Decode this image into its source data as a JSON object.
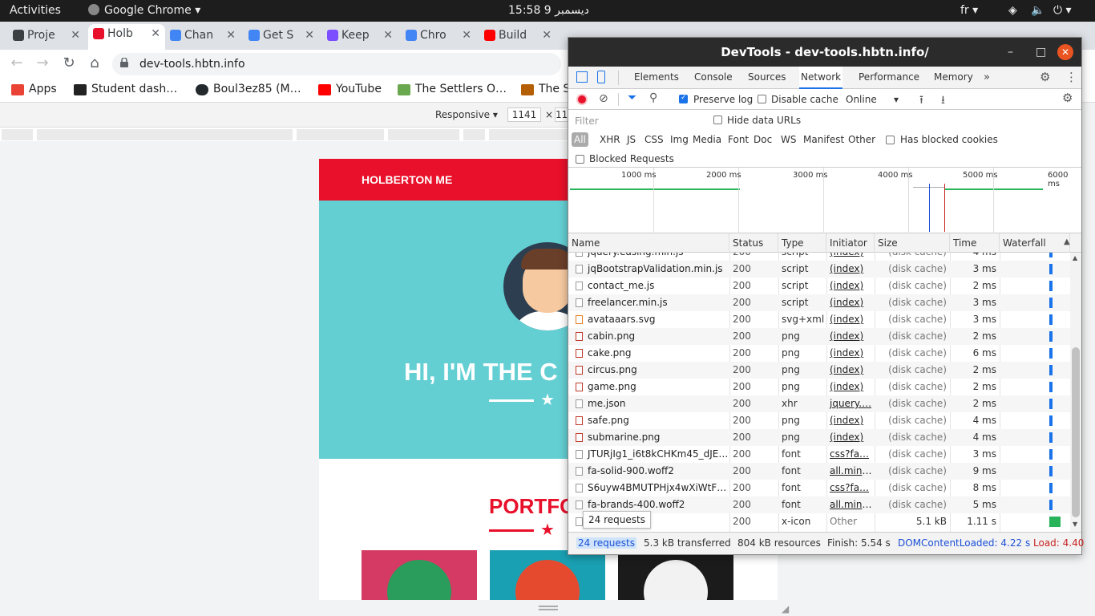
{
  "system_bar": {
    "activities": "Activities",
    "app_name": "Google Chrome",
    "clock": "15:58  9 ديسمبر",
    "language": "fr"
  },
  "tabs": [
    {
      "label": "Proje",
      "color": "#3c4043",
      "active": false
    },
    {
      "label": "Holb",
      "color": "#e8102a",
      "active": true
    },
    {
      "label": "Chan",
      "color": "#4285f4",
      "active": false
    },
    {
      "label": "Get S",
      "color": "#4285f4",
      "active": false
    },
    {
      "label": "Keep",
      "color": "#7c4dff",
      "active": false
    },
    {
      "label": "Chro",
      "color": "#4285f4",
      "active": false
    },
    {
      "label": "Build",
      "color": "#ff0000",
      "active": false
    }
  ],
  "address_bar": {
    "url": "dev-tools.hbtn.info"
  },
  "bookmarks": [
    {
      "label": "Apps"
    },
    {
      "label": "Student dash…"
    },
    {
      "label": "Boul3ez85 (M…"
    },
    {
      "label": "YouTube"
    },
    {
      "label": "The Settlers O…"
    },
    {
      "label": "The S"
    }
  ],
  "device_toolbar": {
    "mode": "Responsive",
    "width": "1141",
    "times": "×",
    "height": "11"
  },
  "website": {
    "brand": "HOLBERTON ME",
    "hero_text": "HI, I'M THE C",
    "portfolio_title": "PORTFO",
    "star": "★"
  },
  "devtools": {
    "title": "DevTools - dev-tools.hbtn.info/",
    "tabs": [
      "Elements",
      "Console",
      "Sources",
      "Network",
      "Performance",
      "Memory"
    ],
    "active_tab": "Network",
    "more_tabs": "»",
    "preserve_log": "Preserve log",
    "disable_cache": "Disable cache",
    "throttling": "Online",
    "filter_placeholder": "Filter",
    "hide_data_urls": "Hide data URLs",
    "resource_types": [
      "All",
      "XHR",
      "JS",
      "CSS",
      "Img",
      "Media",
      "Font",
      "Doc",
      "WS",
      "Manifest",
      "Other"
    ],
    "has_blocked_cookies": "Has blocked cookies",
    "blocked_requests": "Blocked Requests",
    "timeline_labels": [
      "1000 ms",
      "2000 ms",
      "3000 ms",
      "4000 ms",
      "5000 ms",
      "6000 ms"
    ],
    "columns": [
      "Name",
      "Status",
      "Type",
      "Initiator",
      "Size",
      "Time",
      "Waterfall"
    ],
    "requests": [
      {
        "name": "jquery.easing.min.js",
        "status": "200",
        "type": "script",
        "initiator": "(index)",
        "size": "(disk cache)",
        "time": "4 ms"
      },
      {
        "name": "jqBootstrapValidation.min.js",
        "status": "200",
        "type": "script",
        "initiator": "(index)",
        "size": "(disk cache)",
        "time": "3 ms"
      },
      {
        "name": "contact_me.js",
        "status": "200",
        "type": "script",
        "initiator": "(index)",
        "size": "(disk cache)",
        "time": "2 ms"
      },
      {
        "name": "freelancer.min.js",
        "status": "200",
        "type": "script",
        "initiator": "(index)",
        "size": "(disk cache)",
        "time": "3 ms"
      },
      {
        "name": "avataaars.svg",
        "status": "200",
        "type": "svg+xml",
        "initiator": "(index)",
        "size": "(disk cache)",
        "time": "3 ms"
      },
      {
        "name": "cabin.png",
        "status": "200",
        "type": "png",
        "initiator": "(index)",
        "size": "(disk cache)",
        "time": "2 ms"
      },
      {
        "name": "cake.png",
        "status": "200",
        "type": "png",
        "initiator": "(index)",
        "size": "(disk cache)",
        "time": "6 ms"
      },
      {
        "name": "circus.png",
        "status": "200",
        "type": "png",
        "initiator": "(index)",
        "size": "(disk cache)",
        "time": "2 ms"
      },
      {
        "name": "game.png",
        "status": "200",
        "type": "png",
        "initiator": "(index)",
        "size": "(disk cache)",
        "time": "2 ms"
      },
      {
        "name": "me.json",
        "status": "200",
        "type": "xhr",
        "initiator": "jquery.…",
        "size": "(disk cache)",
        "time": "2 ms"
      },
      {
        "name": "safe.png",
        "status": "200",
        "type": "png",
        "initiator": "(index)",
        "size": "(disk cache)",
        "time": "4 ms"
      },
      {
        "name": "submarine.png",
        "status": "200",
        "type": "png",
        "initiator": "(index)",
        "size": "(disk cache)",
        "time": "4 ms"
      },
      {
        "name": "JTURjIg1_i6t8kCHKm45_dJE…",
        "status": "200",
        "type": "font",
        "initiator": "css?fa…",
        "size": "(disk cache)",
        "time": "3 ms"
      },
      {
        "name": "fa-solid-900.woff2",
        "status": "200",
        "type": "font",
        "initiator": "all.min.…",
        "size": "(disk cache)",
        "time": "9 ms"
      },
      {
        "name": "S6uyw4BMUTPHjx4wXiWtFC…",
        "status": "200",
        "type": "font",
        "initiator": "css?fa…",
        "size": "(disk cache)",
        "time": "8 ms"
      },
      {
        "name": "fa-brands-400.woff2",
        "status": "200",
        "type": "font",
        "initiator": "all.min.…",
        "size": "(disk cache)",
        "time": "5 ms"
      },
      {
        "name": "",
        "status": "200",
        "type": "x-icon",
        "initiator": "Other",
        "size": "5.1 kB",
        "time": "1.11 s"
      }
    ],
    "tooltip": "24 requests",
    "summary": {
      "requests": "24 requests",
      "transferred": "5.3 kB transferred",
      "resources": "804 kB resources",
      "finish": "Finish: 5.54 s",
      "dom_content_loaded": "DOMContentLoaded: 4.22 s",
      "load": "Load: 4.40"
    }
  },
  "colors": {
    "brand_red": "#e8102a",
    "hero_teal": "#63cfd3",
    "devtools_accent": "#1a73e8",
    "dcl_blue": "#1a4fd6",
    "load_red": "#c5221f"
  }
}
